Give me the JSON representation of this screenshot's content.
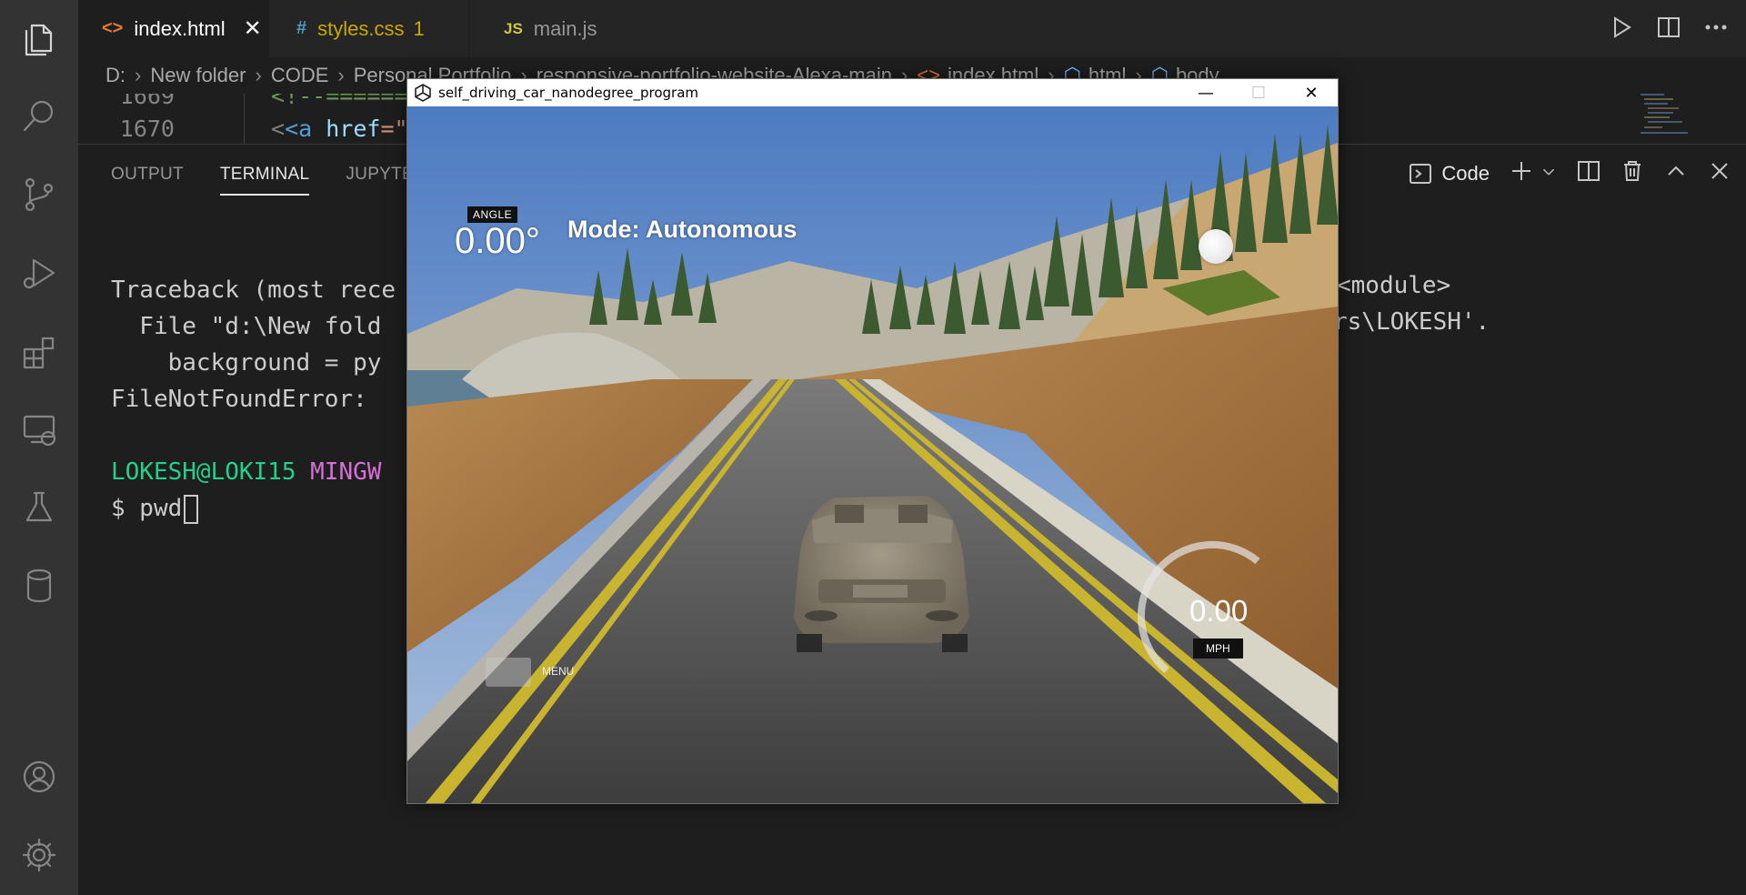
{
  "activity_bar": {
    "items": [
      {
        "name": "explorer-icon"
      },
      {
        "name": "search-icon"
      },
      {
        "name": "source-control-icon"
      },
      {
        "name": "run-debug-icon"
      },
      {
        "name": "extensions-icon"
      },
      {
        "name": "remote-explorer-icon"
      },
      {
        "name": "testing-icon"
      },
      {
        "name": "database-icon"
      }
    ],
    "bottom": [
      {
        "name": "account-icon"
      },
      {
        "name": "settings-gear-icon"
      }
    ]
  },
  "tabs": [
    {
      "icon": "<>",
      "label": "index.html",
      "color": "#ffffff",
      "icon_color": "#e37933",
      "close": "✕"
    },
    {
      "icon": "#",
      "label": "styles.css",
      "color": "#cca700",
      "icon_color": "#519aba",
      "badge": "1"
    },
    {
      "icon": "JS",
      "label": "main.js",
      "color": "#969696",
      "icon_color": "#cbcb41"
    }
  ],
  "breadcrumb": [
    "D:",
    "New folder",
    "CODE",
    "Personal Portfolio",
    "responsive-portfolio-website-Alexa-main",
    "index.html",
    "html",
    "body"
  ],
  "code_lines": [
    {
      "num": "1669",
      "text": "<!--======="
    },
    {
      "num": "1670",
      "text_tag": "<a",
      "text_attr": "href",
      "text_rest": "=\"#"
    }
  ],
  "panel": {
    "tabs": [
      "OUTPUT",
      "TERMINAL",
      "JUPYTER"
    ],
    "active_tab": "TERMINAL",
    "terminal_profile": "Code",
    "terminal_lines": {
      "l1": "Traceback (most rece",
      "l2": "  File \"d:\\New fold",
      "l2_right": "<module>",
      "l3": "    background = py",
      "l4": "FileNotFoundError: ",
      "l4_right": "rs\\LOKESH'.",
      "prompt_user": "LOKESH@LOKI15",
      "prompt_env": "MINGW",
      "command": "$ pwd"
    }
  },
  "simulator": {
    "title": "self_driving_car_nanodegree_program",
    "angle_label": "ANGLE",
    "angle_value": "0.00°",
    "mode": "Mode: Autonomous",
    "speed_value": "0.00",
    "speed_unit": "MPH",
    "menu_label": "MENU",
    "window_buttons": {
      "minimize": "—",
      "maximize": "☐",
      "close": "✕"
    }
  }
}
